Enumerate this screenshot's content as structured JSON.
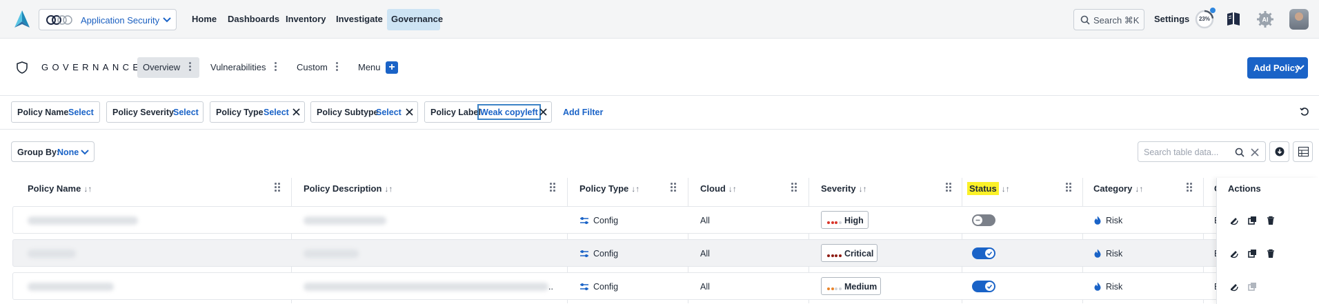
{
  "topnav": {
    "app_selector": "Application Security",
    "items": [
      "Home",
      "Dashboards",
      "Inventory",
      "Investigate",
      "Governance"
    ],
    "search_label": "Search ⌘K",
    "settings": "Settings",
    "progress": "23%",
    "ai_label": "AI"
  },
  "header": {
    "title": "GOVERNANCE",
    "tabs": [
      "Overview",
      "Vulnerabilities",
      "Custom",
      "Menu"
    ],
    "add_policy": "Add Policy"
  },
  "filters": {
    "chips": [
      {
        "key": "Policy Name",
        "value": "Select"
      },
      {
        "key": "Policy Severity",
        "value": "Select"
      },
      {
        "key": "Policy Type",
        "value": "Select"
      },
      {
        "key": "Policy Subtype",
        "value": "Select"
      },
      {
        "key": "Policy Label",
        "value": "Weak copyleft"
      }
    ],
    "add_filter": "Add Filter"
  },
  "toolbar": {
    "group_by_label": "Group By:",
    "group_by_value": "None",
    "search_placeholder": "Search table data..."
  },
  "table": {
    "columns": [
      "Policy Name",
      "Policy Description",
      "Policy Type",
      "Cloud",
      "Severity",
      "Status",
      "Category",
      "C",
      "Actions"
    ],
    "rows": [
      {
        "type": "Config",
        "cloud": "All",
        "severity": "High",
        "status": "off",
        "category": "Risk",
        "col8": "E"
      },
      {
        "type": "Config",
        "cloud": "All",
        "severity": "Critical",
        "status": "on",
        "category": "Risk",
        "col8": "E"
      },
      {
        "type": "Config",
        "cloud": "All",
        "severity": "Medium",
        "status": "on",
        "category": "Risk",
        "col8": "E"
      }
    ]
  },
  "colors": {
    "accent": "#1a63c7",
    "nav_active_bg": "#cde4f4",
    "status_highlight": "#fbf128",
    "severity_high": "#d9362b",
    "severity_critical": "#8e1b13",
    "severity_medium": "#e8832a"
  }
}
